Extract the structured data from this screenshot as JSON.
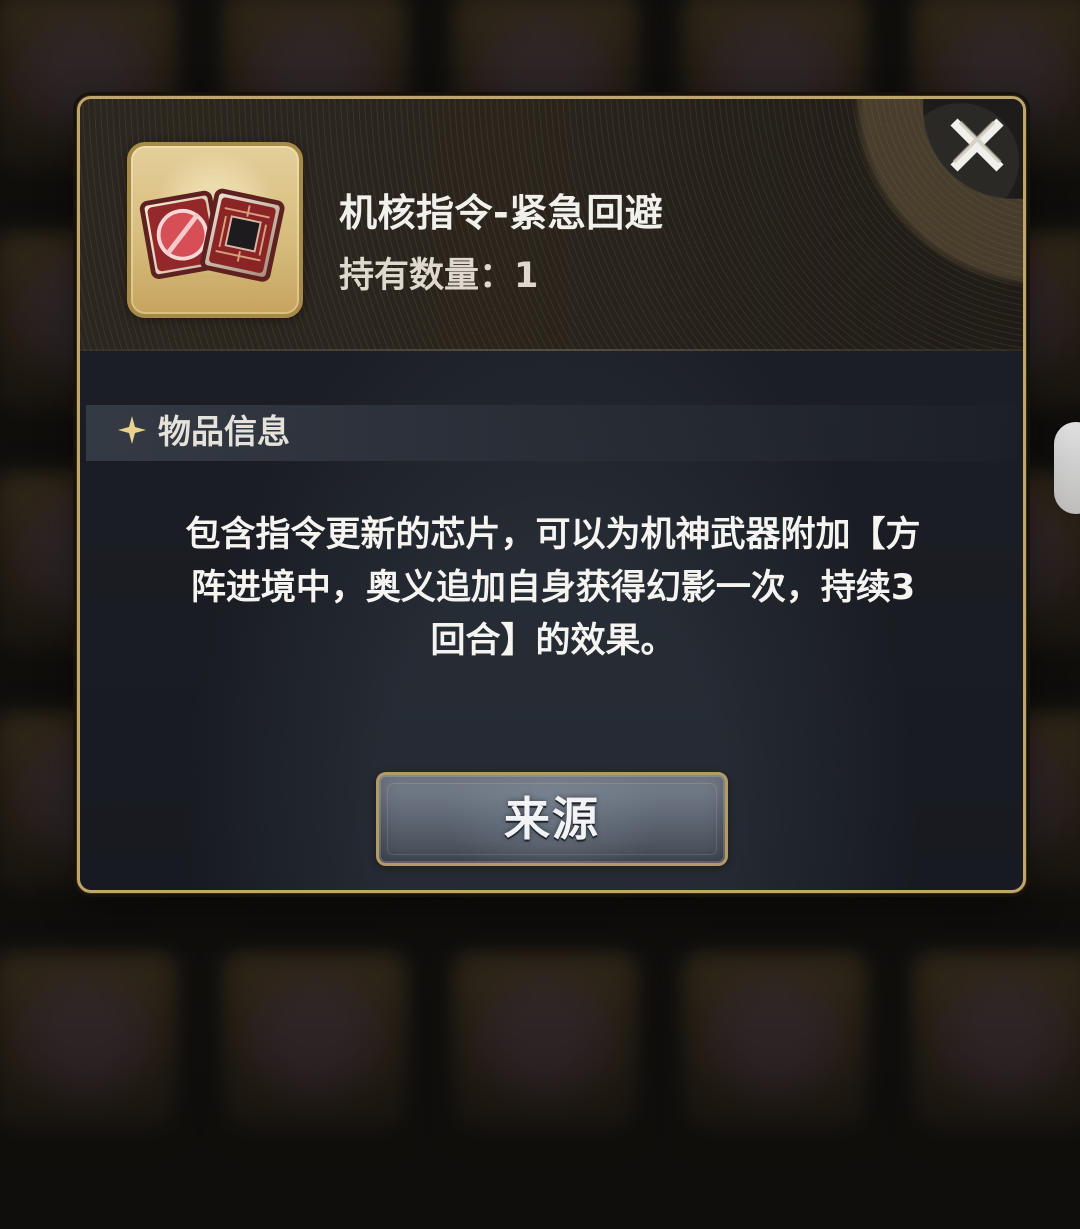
{
  "item": {
    "name": "机核指令-紧急回避",
    "quantity_label": "持有数量：1"
  },
  "section": {
    "title": "物品信息"
  },
  "description": "包含指令更新的芯片，可以为机神武器附加【方\n阵进境中，奥义追加自身获得幻影一次，持续3\n回合】的效果。",
  "actions": {
    "source_label": "来源"
  },
  "icons": {
    "close": "close-icon",
    "item": "item-chip-icon",
    "section": "star-icon"
  },
  "colors": {
    "modal_border": "#bfa66a",
    "header_bg": "#2a241d",
    "panel_bg": "#1d2128",
    "section_bg": "#343a44",
    "text_main": "#f5f4f1",
    "text_secondary": "#ded8ce",
    "button_bg": "#5d6672",
    "button_border": "#b59a62"
  }
}
